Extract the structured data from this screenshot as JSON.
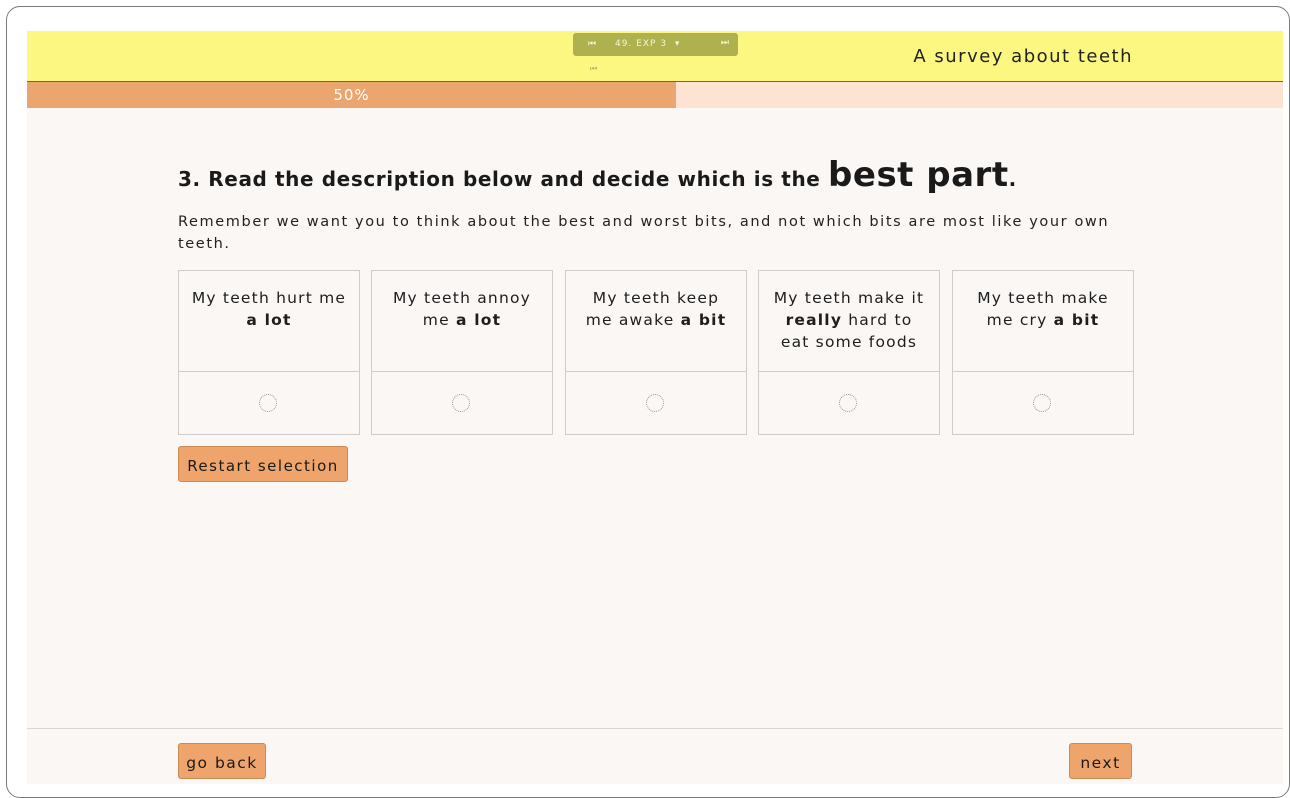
{
  "header": {
    "survey_title": "A survey about teeth",
    "nav": {
      "first_icon": "first-page-icon",
      "label": "49. EXP 3",
      "dropdown_icon": "▾",
      "last_icon": "last-page-icon",
      "handle": "⏮"
    }
  },
  "progress": {
    "label": "50%",
    "fraction": 0.5,
    "fill_color": "#eba56e",
    "track_color": "#fde3d2"
  },
  "question": {
    "prefix": "3. Read the description below and decide which is the",
    "emphasis": "best part",
    "suffix": "."
  },
  "instruction": "Remember we want you to think about the best and worst bits, and not which bits are most like your own teeth.",
  "options": [
    {
      "pre": "My teeth hurt me",
      "bold": "a lot",
      "post": "",
      "selected": false
    },
    {
      "pre": "My teeth annoy me",
      "bold": "a lot",
      "post": "",
      "selected": false
    },
    {
      "pre": "My teeth keep me awake",
      "bold": "a bit",
      "post": "",
      "selected": false
    },
    {
      "pre": "My teeth make it",
      "bold": "really",
      "post": "hard to eat some foods",
      "selected": false
    },
    {
      "pre": "My teeth make me cry",
      "bold": "a bit",
      "post": "",
      "selected": false
    }
  ],
  "buttons": {
    "restart": "Restart selection",
    "go_back": "go back",
    "next": "next"
  },
  "colors": {
    "header_bg": "#fbf781",
    "button_bg": "#eea46a",
    "page_bg": "#faf7f5"
  }
}
